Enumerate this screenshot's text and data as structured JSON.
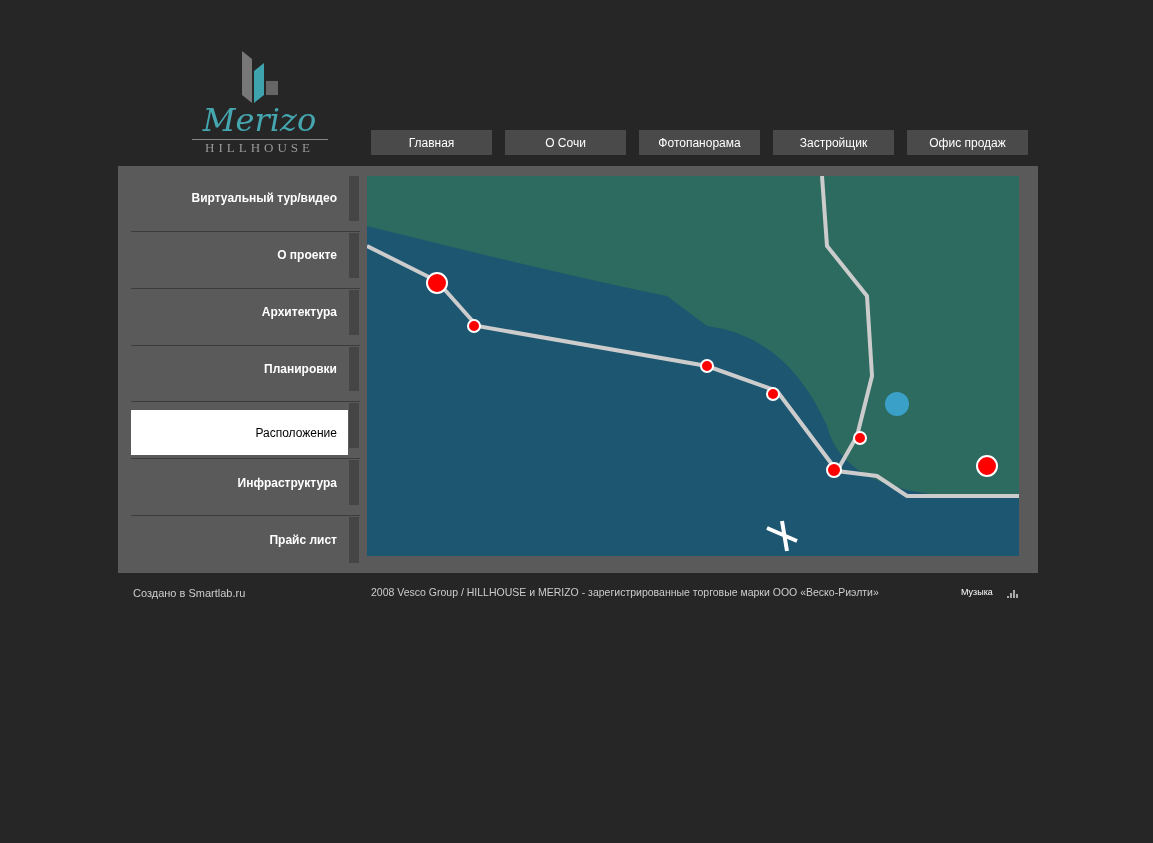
{
  "logo": {
    "script": "Merizo",
    "wordmark": "HILLHOUSE"
  },
  "nav": [
    {
      "label": "Главная"
    },
    {
      "label": "О Сочи"
    },
    {
      "label": "Фотопанорама"
    },
    {
      "label": "Застройщик"
    },
    {
      "label": "Офис продаж"
    }
  ],
  "sidebar": {
    "items": [
      {
        "label": "Виртуальный тур/видео",
        "selected": false
      },
      {
        "label": "О проекте",
        "selected": false
      },
      {
        "label": "Архитектура",
        "selected": false
      },
      {
        "label": "Планировки",
        "selected": false
      },
      {
        "label": "Расположение",
        "selected": true
      },
      {
        "label": "Инфраструктура",
        "selected": false
      },
      {
        "label": "Прайс лист",
        "selected": false
      }
    ]
  },
  "footer": {
    "credit": "Создано в Smartlab.ru",
    "copyright": "2008 Vesco Group / HILLHOUSE и MERIZO - зарегистрированные торговые марки ООО «Веско-Риэлти»",
    "music": "Музыка"
  }
}
